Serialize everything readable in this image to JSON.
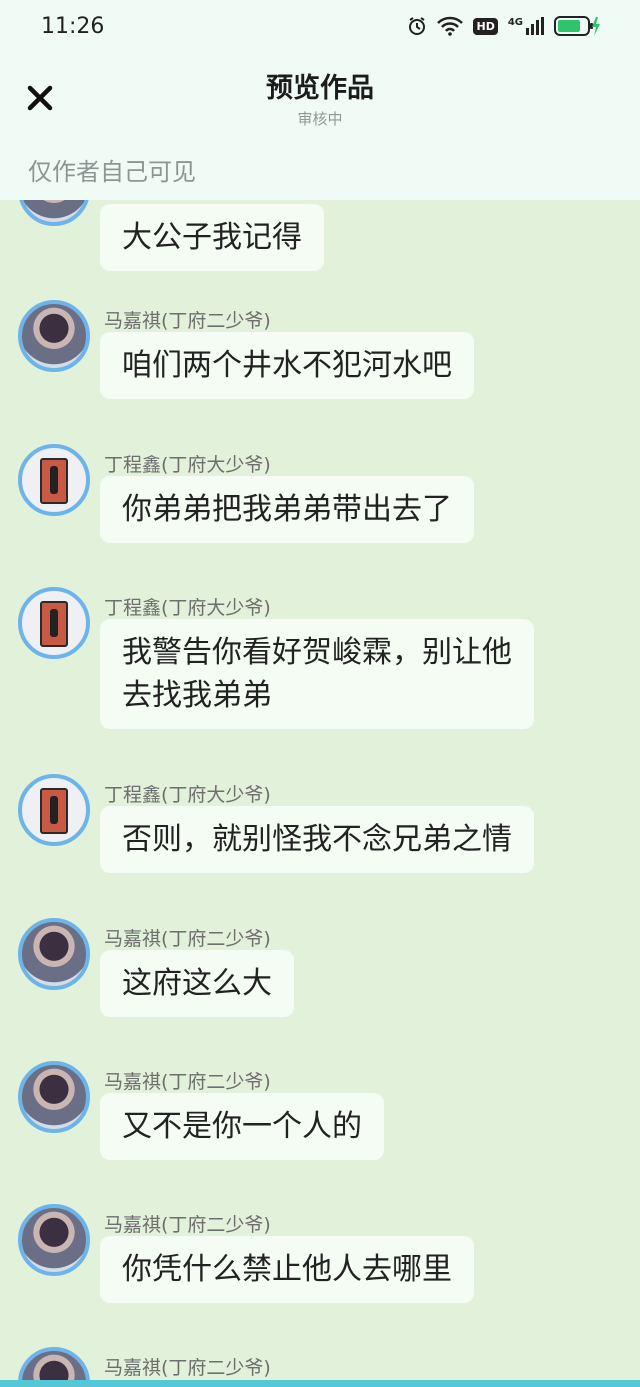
{
  "status": {
    "time": "11:26",
    "network": "4G",
    "hd": "HD"
  },
  "header": {
    "title": "预览作品",
    "subtitle": "审核中",
    "visibility_note": "仅作者自己可见"
  },
  "messages": [
    {
      "sender": "",
      "avatar": "ma",
      "lines": [
        "大公子我记得"
      ]
    },
    {
      "sender": "马嘉祺(丁府二少爷)",
      "avatar": "ma",
      "lines": [
        "咱们两个井水不犯河水吧"
      ]
    },
    {
      "sender": "丁程鑫(丁府大少爷)",
      "avatar": "ding",
      "lines": [
        "你弟弟把我弟弟带出去了"
      ]
    },
    {
      "sender": "丁程鑫(丁府大少爷)",
      "avatar": "ding",
      "lines": [
        "我警告你看好贺峻霖，别让他",
        "去找我弟弟"
      ]
    },
    {
      "sender": "丁程鑫(丁府大少爷)",
      "avatar": "ding",
      "lines": [
        "否则，就别怪我不念兄弟之情"
      ]
    },
    {
      "sender": "马嘉祺(丁府二少爷)",
      "avatar": "ma",
      "lines": [
        "这府这么大"
      ]
    },
    {
      "sender": "马嘉祺(丁府二少爷)",
      "avatar": "ma",
      "lines": [
        "又不是你一个人的"
      ]
    },
    {
      "sender": "马嘉祺(丁府二少爷)",
      "avatar": "ma",
      "lines": [
        "你凭什么禁止他人去哪里"
      ]
    },
    {
      "sender": "马嘉祺(丁府二少爷)",
      "avatar": "ma",
      "lines": []
    }
  ],
  "colors": {
    "chat_bg": "#e2f1da",
    "bubble": "#f4fcf4",
    "avatar_ring": "#6cb4ea"
  }
}
